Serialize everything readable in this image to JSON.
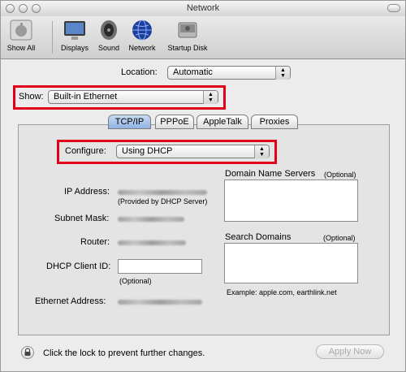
{
  "window": {
    "title": "Network"
  },
  "toolbar": {
    "items": [
      {
        "label": "Show All",
        "icon": "apple-grid-icon"
      },
      {
        "label": "Displays",
        "icon": "display-icon"
      },
      {
        "label": "Sound",
        "icon": "speaker-icon"
      },
      {
        "label": "Network",
        "icon": "globe-icon"
      },
      {
        "label": "Startup Disk",
        "icon": "hard-disk-icon"
      }
    ]
  },
  "location": {
    "label": "Location:",
    "value": "Automatic"
  },
  "show": {
    "label": "Show:",
    "value": "Built-in Ethernet"
  },
  "tabs": [
    {
      "label": "TCP/IP",
      "active": true
    },
    {
      "label": "PPPoE",
      "active": false
    },
    {
      "label": "AppleTalk",
      "active": false
    },
    {
      "label": "Proxies",
      "active": false
    }
  ],
  "configure": {
    "label": "Configure:",
    "value": "Using DHCP"
  },
  "fields": {
    "ip_address": "IP Address:",
    "ip_note": "(Provided by DHCP Server)",
    "subnet_mask": "Subnet Mask:",
    "router": "Router:",
    "dhcp_client_id": "DHCP Client ID:",
    "dhcp_client_id_value": "",
    "dhcp_note": "(Optional)",
    "ethernet_address": "Ethernet Address:"
  },
  "dns": {
    "label": "Domain Name Servers",
    "optional": "(Optional)",
    "value": ""
  },
  "search_domains": {
    "label": "Search Domains",
    "optional": "(Optional)",
    "value": "",
    "example": "Example: apple.com, earthlink.net"
  },
  "footer": {
    "lock_text": "Click the lock to prevent further changes.",
    "apply_label": "Apply Now"
  },
  "colors": {
    "highlight": "#e0001a",
    "active_tab": "#8fb2e3"
  }
}
